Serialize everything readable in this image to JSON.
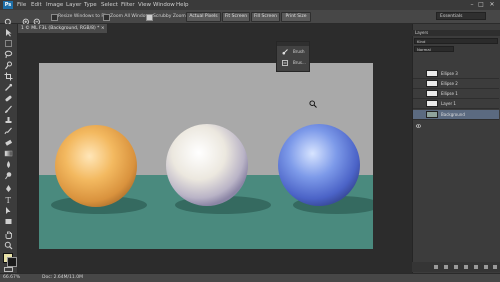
{
  "menubar": {
    "logo": "Ps",
    "items": [
      "File",
      "Edit",
      "Image",
      "Layer",
      "Type",
      "Select",
      "Filter",
      "View",
      "Window",
      "Help"
    ],
    "window_controls": [
      "–",
      "□",
      "✕"
    ]
  },
  "options_bar": {
    "resize_windows_label": "Resize Windows to Fit",
    "zoom_all_label": "Zoom All Windows",
    "scrubby_zoom_label": "Scrubby Zoom",
    "buttons": [
      "Actual Pixels",
      "Fit Screen",
      "Fill Screen",
      "Print Size"
    ],
    "workspace": "Essentials"
  },
  "document": {
    "tab_title": "1 © ML F3L (Background, RGB/8) * ×"
  },
  "float_panel": {
    "items": [
      "Brush",
      "Brus..."
    ]
  },
  "layers_panel": {
    "title": "Layers",
    "filter_value": "Kind",
    "blend_mode": "Normal",
    "layers": [
      {
        "name": "Ellipse 3",
        "selected": false
      },
      {
        "name": "Ellipse 2",
        "selected": false
      },
      {
        "name": "Ellipse 1",
        "selected": false
      },
      {
        "name": "Layer 1",
        "selected": false
      },
      {
        "name": "Background",
        "selected": true
      }
    ]
  },
  "statusbar": {
    "zoom": "66.67%",
    "doc_info": "Doc: 2.64M/11.0M"
  },
  "icons": {
    "toolbox": [
      "move-icon",
      "marquee-icon",
      "lasso-icon",
      "quick-select-icon",
      "crop-icon",
      "eyedropper-icon",
      "healing-brush-icon",
      "brush-icon",
      "clone-stamp-icon",
      "history-brush-icon",
      "eraser-icon",
      "gradient-icon",
      "blur-icon",
      "dodge-icon",
      "pen-icon",
      "type-icon",
      "path-select-icon",
      "shape-icon",
      "hand-icon",
      "zoom-icon"
    ],
    "options": [
      "zoom-tool-icon",
      "zoom-in-icon",
      "zoom-out-icon"
    ]
  },
  "colors": {
    "menubar": "#3a3a3a",
    "options_bar": "#474747",
    "workspace": "#2c2c2c",
    "selected_layer": "#5b6a80",
    "canvas_wall": "#a9a9a9",
    "canvas_floor": "#4a8a7e",
    "sphere_orange": "#f0b45a",
    "sphere_white": "#e6e2dc",
    "sphere_blue": "#6f8fe0"
  }
}
